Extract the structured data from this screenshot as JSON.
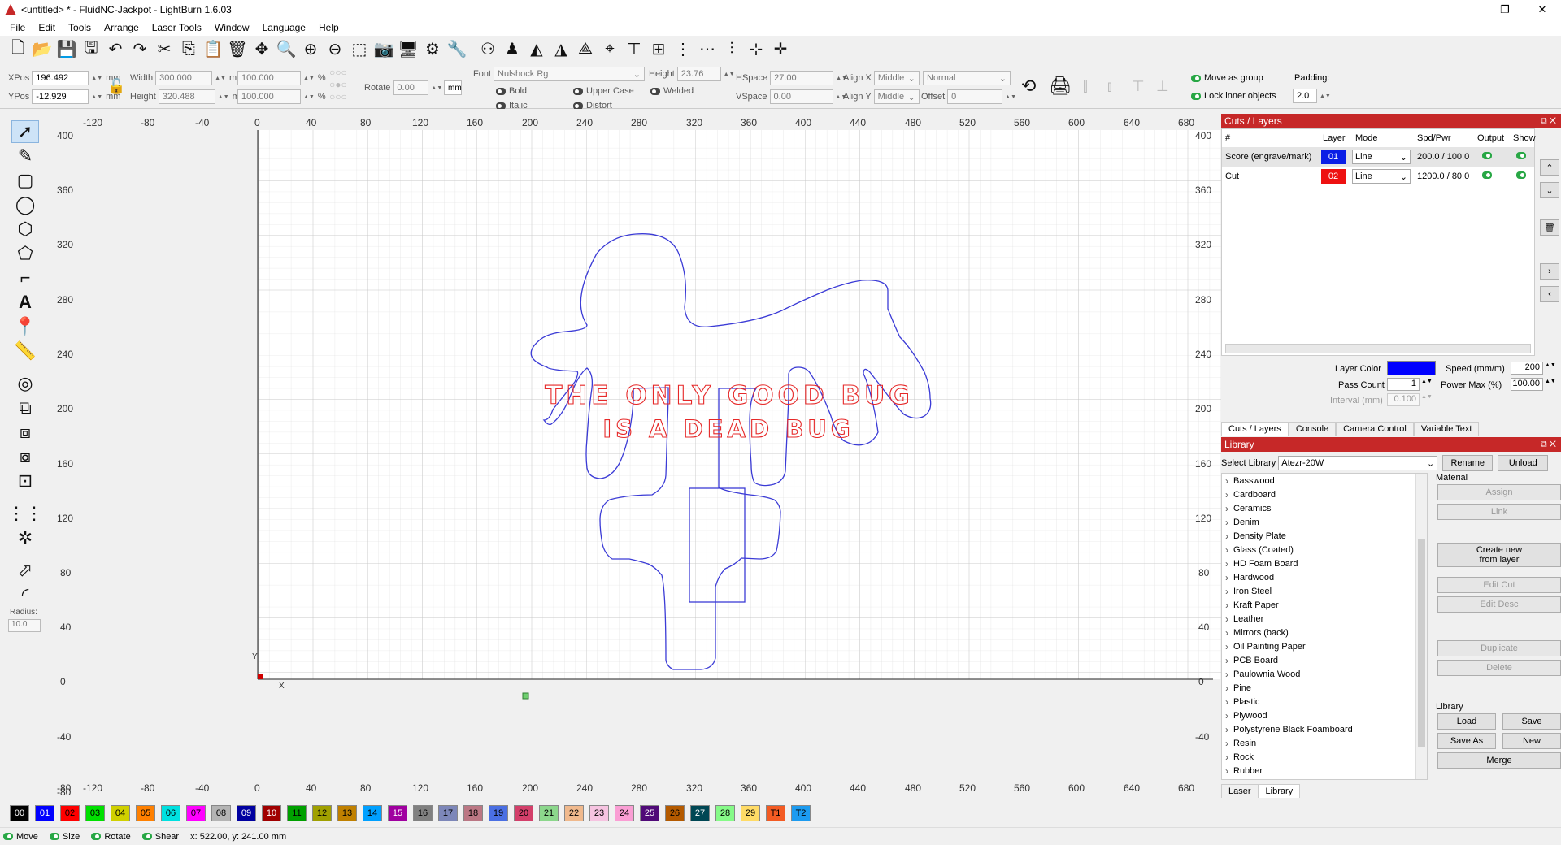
{
  "window": {
    "title": "<untitled> * - FluidNC-Jackpot - LightBurn 1.6.03",
    "controls": [
      "—",
      "❐",
      "✕"
    ]
  },
  "menu": [
    "File",
    "Edit",
    "Tools",
    "Arrange",
    "Laser Tools",
    "Window",
    "Language",
    "Help"
  ],
  "props": {
    "xpos_label": "XPos",
    "xpos": "196.492",
    "ypos_label": "YPos",
    "ypos": "-12.929",
    "unit": "mm",
    "width_label": "Width",
    "width": "300.000",
    "height_label": "Height",
    "height": "320.488",
    "scale_w": "100.000",
    "scale_h": "100.000",
    "pct": "%",
    "rotate_label": "Rotate",
    "rotate": "0.00",
    "mm_toggle": "mm",
    "font_label": "Font",
    "font": "Nulshock Rg",
    "text_height_label": "Height",
    "text_height": "23.76",
    "hspace_label": "HSpace",
    "hspace": "27.00",
    "vspace_label": "VSpace",
    "vspace": "0.00",
    "alignx_label": "Align X",
    "alignx": "Middle",
    "aligny_label": "Align Y",
    "aligny": "Middle",
    "normal": "Normal",
    "offset_label": "Offset",
    "offset": "0",
    "bold": "Bold",
    "italic": "Italic",
    "upper_case": "Upper Case",
    "distort": "Distort",
    "welded": "Welded",
    "move_as_group": "Move as group",
    "lock_inner": "Lock inner objects",
    "padding_label": "Padding:",
    "padding": "2.0"
  },
  "left_tools": {
    "radius_label": "Radius:",
    "radius": "10.0"
  },
  "canvas": {
    "x_ticks": [
      "-120",
      "-80",
      "-40",
      "0",
      "40",
      "80",
      "120",
      "160",
      "200",
      "240",
      "280",
      "320",
      "360",
      "400",
      "440",
      "480",
      "520",
      "560",
      "600",
      "640",
      "680"
    ],
    "y_ticks": [
      "400",
      "360",
      "320",
      "280",
      "240",
      "200",
      "160",
      "120",
      "80",
      "40",
      "0",
      "-40",
      "-80"
    ],
    "x_axis_label": "X",
    "y_axis_label": "Y",
    "text_line1": "THE ONLY GOOD BUG",
    "text_line2": "IS A DEAD BUG"
  },
  "cuts_layers": {
    "title": "Cuts / Layers",
    "columns": [
      "#",
      "Layer",
      "Mode",
      "Spd/Pwr",
      "Output",
      "Show"
    ],
    "rows": [
      {
        "name": "Score (engrave/mark)",
        "layer": "01",
        "color": "#0a1ee6",
        "mode": "Line",
        "spdpwr": "200.0 / 100.0"
      },
      {
        "name": "Cut",
        "layer": "02",
        "color": "#ee1111",
        "mode": "Line",
        "spdpwr": "1200.0 / 80.0"
      }
    ],
    "layer_color_label": "Layer Color",
    "speed_label": "Speed (mm/m)",
    "speed": "200",
    "pass_count_label": "Pass Count",
    "pass_count": "1",
    "power_max_label": "Power Max (%)",
    "power_max": "100.00",
    "interval_label": "Interval (mm)",
    "interval": "0.100",
    "tabs": [
      "Cuts / Layers",
      "Console",
      "Camera Control",
      "Variable Text"
    ]
  },
  "library": {
    "title": "Library",
    "select_label": "Select Library",
    "selected": "Atezr-20W",
    "rename": "Rename",
    "unload": "Unload",
    "material_label": "Material",
    "items": [
      "Basswood",
      "Cardboard",
      "Ceramics",
      "Denim",
      "Density Plate",
      "Glass (Coated)",
      "HD Foam Board",
      "Hardwood",
      "Iron Steel",
      "Kraft Paper",
      "Leather",
      "Mirrors (back)",
      "Oil Painting Paper",
      "PCB Board",
      "Paulownia Wood",
      "Pine",
      "Plastic",
      "Plywood",
      "Polystyrene Black Foamboard",
      "Resin",
      "Rock",
      "Rubber"
    ],
    "assign": "Assign",
    "link": "Link",
    "create_new": "Create new",
    "from_layer": "from layer",
    "edit_cut": "Edit Cut",
    "edit_desc": "Edit Desc",
    "duplicate": "Duplicate",
    "delete": "Delete",
    "library_label": "Library",
    "load": "Load",
    "save": "Save",
    "save_as": "Save As",
    "new": "New",
    "merge": "Merge",
    "tabs": [
      "Laser",
      "Library"
    ]
  },
  "palette": [
    {
      "label": "00",
      "color": "#000000",
      "text": "#ffffff"
    },
    {
      "label": "01",
      "color": "#0000ff",
      "text": "#ffffff"
    },
    {
      "label": "02",
      "color": "#ff0000",
      "text": "#000000"
    },
    {
      "label": "03",
      "color": "#00e000",
      "text": "#000000"
    },
    {
      "label": "04",
      "color": "#d0d000",
      "text": "#000000"
    },
    {
      "label": "05",
      "color": "#ff8000",
      "text": "#000000"
    },
    {
      "label": "06",
      "color": "#00e0e0",
      "text": "#000000"
    },
    {
      "label": "07",
      "color": "#ff00ff",
      "text": "#000000"
    },
    {
      "label": "08",
      "color": "#b4b4b4",
      "text": "#000000"
    },
    {
      "label": "09",
      "color": "#0000a0",
      "text": "#ffffff"
    },
    {
      "label": "10",
      "color": "#a00000",
      "text": "#ffffff"
    },
    {
      "label": "11",
      "color": "#00a000",
      "text": "#000000"
    },
    {
      "label": "12",
      "color": "#a0a000",
      "text": "#000000"
    },
    {
      "label": "13",
      "color": "#c08000",
      "text": "#000000"
    },
    {
      "label": "14",
      "color": "#00a0ff",
      "text": "#000000"
    },
    {
      "label": "15",
      "color": "#a000a0",
      "text": "#ffffff"
    },
    {
      "label": "16",
      "color": "#808080",
      "text": "#000000"
    },
    {
      "label": "17",
      "color": "#7d87b9",
      "text": "#000000"
    },
    {
      "label": "18",
      "color": "#bb7784",
      "text": "#000000"
    },
    {
      "label": "19",
      "color": "#4a6fe3",
      "text": "#000000"
    },
    {
      "label": "20",
      "color": "#d33f6a",
      "text": "#000000"
    },
    {
      "label": "21",
      "color": "#8cd78c",
      "text": "#000000"
    },
    {
      "label": "22",
      "color": "#f0b98d",
      "text": "#000000"
    },
    {
      "label": "23",
      "color": "#f6c4e1",
      "text": "#000000"
    },
    {
      "label": "24",
      "color": "#fa9ed4",
      "text": "#000000"
    },
    {
      "label": "25",
      "color": "#500a78",
      "text": "#ffffff"
    },
    {
      "label": "26",
      "color": "#b45a00",
      "text": "#000000"
    },
    {
      "label": "27",
      "color": "#004754",
      "text": "#ffffff"
    },
    {
      "label": "28",
      "color": "#86fa88",
      "text": "#000000"
    },
    {
      "label": "29",
      "color": "#ffdb66",
      "text": "#000000"
    },
    {
      "label": "T1",
      "color": "#f35b23",
      "text": "#000000"
    },
    {
      "label": "T2",
      "color": "#1c9bf0",
      "text": "#000000"
    }
  ],
  "status": {
    "move": "Move",
    "size": "Size",
    "rotate": "Rotate",
    "shear": "Shear",
    "coords": "x: 522.00, y: 241.00 mm"
  }
}
